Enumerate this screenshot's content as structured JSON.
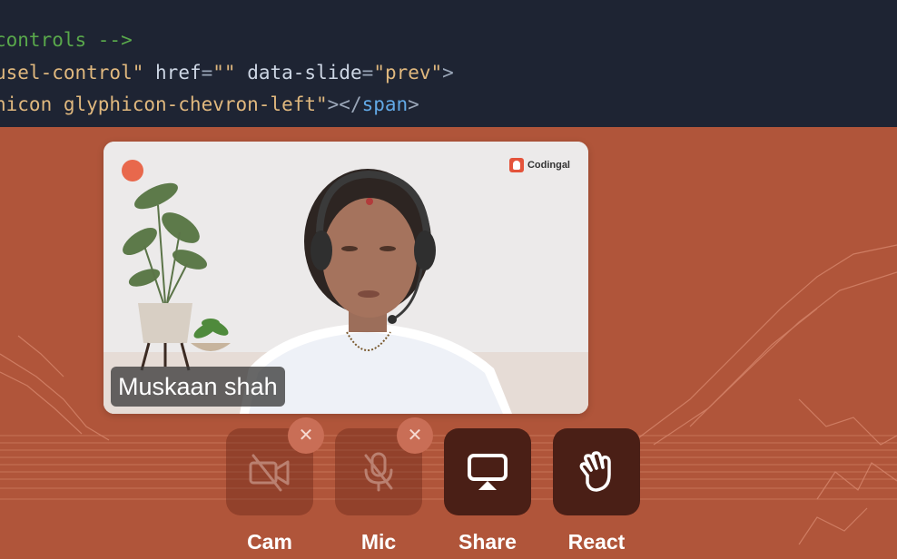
{
  "code_editor": {
    "line1": {
      "comment": "controls -->"
    },
    "line2": {
      "string1": "usel-control\"",
      "attr1": "href",
      "punct1": "=",
      "string2": "\"\"",
      "attr2": "data-slide",
      "punct2": "=",
      "string3": "\"prev\"",
      "close": ">"
    },
    "line3": {
      "string1": "hicon glyphicon-chevron-left\"",
      "punct1": "></",
      "tag": "span",
      "close": ">"
    }
  },
  "video": {
    "participant_name": "Muskaan shah",
    "brand_label": "Codingal",
    "recording_indicator_color": "#e8684c"
  },
  "controls": [
    {
      "label": "Cam",
      "icon": "camera-off-icon",
      "state": "off"
    },
    {
      "label": "Mic",
      "icon": "mic-off-icon",
      "state": "off"
    },
    {
      "label": "Share",
      "icon": "screen-share-icon",
      "state": "on"
    },
    {
      "label": "React",
      "icon": "hand-wave-icon",
      "state": "on"
    }
  ],
  "colors": {
    "stage_background": "#b0553a",
    "editor_background": "#1e2433",
    "active_control": "#4a1f16"
  }
}
